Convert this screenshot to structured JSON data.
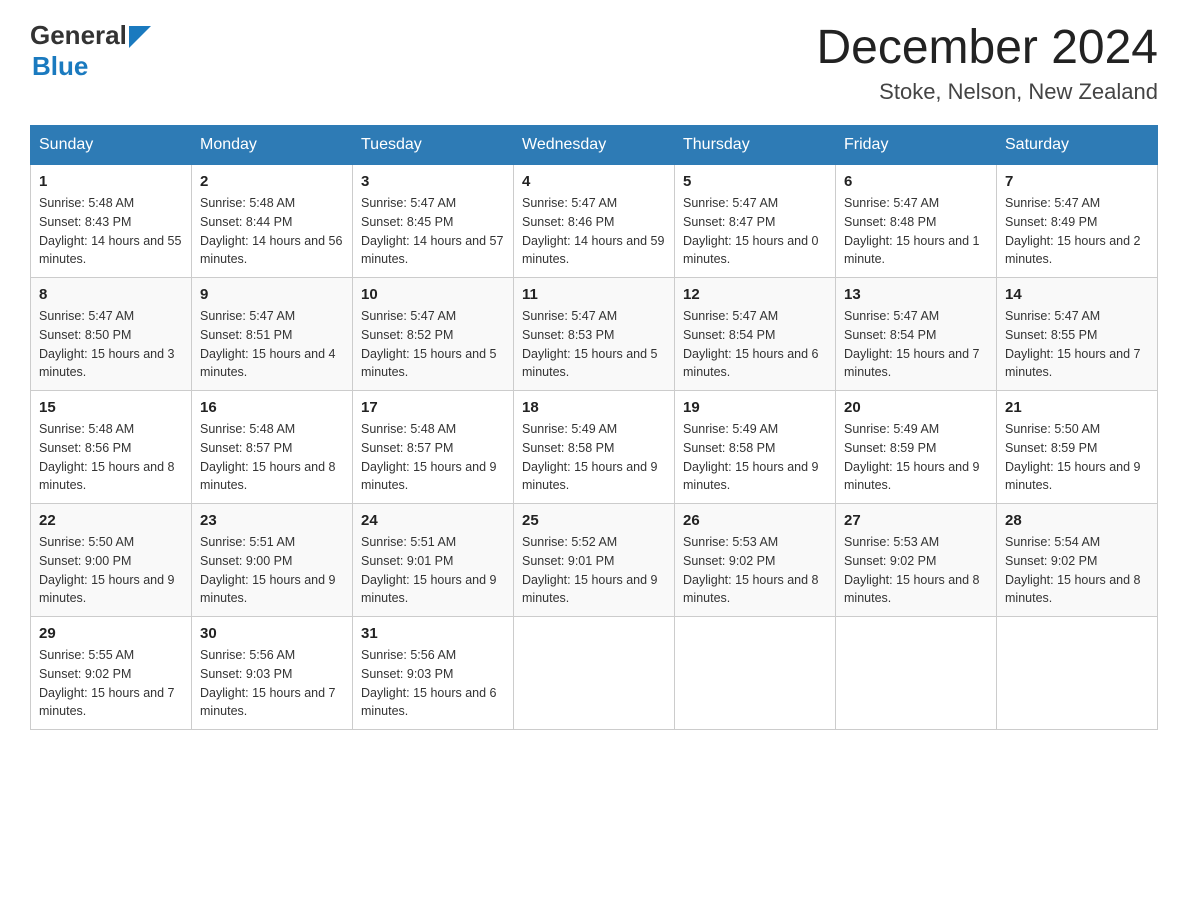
{
  "header": {
    "logo_general": "General",
    "logo_blue": "Blue",
    "title": "December 2024",
    "location": "Stoke, Nelson, New Zealand"
  },
  "weekdays": [
    "Sunday",
    "Monday",
    "Tuesday",
    "Wednesday",
    "Thursday",
    "Friday",
    "Saturday"
  ],
  "weeks": [
    [
      {
        "day": "1",
        "sunrise": "5:48 AM",
        "sunset": "8:43 PM",
        "daylight": "14 hours and 55 minutes."
      },
      {
        "day": "2",
        "sunrise": "5:48 AM",
        "sunset": "8:44 PM",
        "daylight": "14 hours and 56 minutes."
      },
      {
        "day": "3",
        "sunrise": "5:47 AM",
        "sunset": "8:45 PM",
        "daylight": "14 hours and 57 minutes."
      },
      {
        "day": "4",
        "sunrise": "5:47 AM",
        "sunset": "8:46 PM",
        "daylight": "14 hours and 59 minutes."
      },
      {
        "day": "5",
        "sunrise": "5:47 AM",
        "sunset": "8:47 PM",
        "daylight": "15 hours and 0 minutes."
      },
      {
        "day": "6",
        "sunrise": "5:47 AM",
        "sunset": "8:48 PM",
        "daylight": "15 hours and 1 minute."
      },
      {
        "day": "7",
        "sunrise": "5:47 AM",
        "sunset": "8:49 PM",
        "daylight": "15 hours and 2 minutes."
      }
    ],
    [
      {
        "day": "8",
        "sunrise": "5:47 AM",
        "sunset": "8:50 PM",
        "daylight": "15 hours and 3 minutes."
      },
      {
        "day": "9",
        "sunrise": "5:47 AM",
        "sunset": "8:51 PM",
        "daylight": "15 hours and 4 minutes."
      },
      {
        "day": "10",
        "sunrise": "5:47 AM",
        "sunset": "8:52 PM",
        "daylight": "15 hours and 5 minutes."
      },
      {
        "day": "11",
        "sunrise": "5:47 AM",
        "sunset": "8:53 PM",
        "daylight": "15 hours and 5 minutes."
      },
      {
        "day": "12",
        "sunrise": "5:47 AM",
        "sunset": "8:54 PM",
        "daylight": "15 hours and 6 minutes."
      },
      {
        "day": "13",
        "sunrise": "5:47 AM",
        "sunset": "8:54 PM",
        "daylight": "15 hours and 7 minutes."
      },
      {
        "day": "14",
        "sunrise": "5:47 AM",
        "sunset": "8:55 PM",
        "daylight": "15 hours and 7 minutes."
      }
    ],
    [
      {
        "day": "15",
        "sunrise": "5:48 AM",
        "sunset": "8:56 PM",
        "daylight": "15 hours and 8 minutes."
      },
      {
        "day": "16",
        "sunrise": "5:48 AM",
        "sunset": "8:57 PM",
        "daylight": "15 hours and 8 minutes."
      },
      {
        "day": "17",
        "sunrise": "5:48 AM",
        "sunset": "8:57 PM",
        "daylight": "15 hours and 9 minutes."
      },
      {
        "day": "18",
        "sunrise": "5:49 AM",
        "sunset": "8:58 PM",
        "daylight": "15 hours and 9 minutes."
      },
      {
        "day": "19",
        "sunrise": "5:49 AM",
        "sunset": "8:58 PM",
        "daylight": "15 hours and 9 minutes."
      },
      {
        "day": "20",
        "sunrise": "5:49 AM",
        "sunset": "8:59 PM",
        "daylight": "15 hours and 9 minutes."
      },
      {
        "day": "21",
        "sunrise": "5:50 AM",
        "sunset": "8:59 PM",
        "daylight": "15 hours and 9 minutes."
      }
    ],
    [
      {
        "day": "22",
        "sunrise": "5:50 AM",
        "sunset": "9:00 PM",
        "daylight": "15 hours and 9 minutes."
      },
      {
        "day": "23",
        "sunrise": "5:51 AM",
        "sunset": "9:00 PM",
        "daylight": "15 hours and 9 minutes."
      },
      {
        "day": "24",
        "sunrise": "5:51 AM",
        "sunset": "9:01 PM",
        "daylight": "15 hours and 9 minutes."
      },
      {
        "day": "25",
        "sunrise": "5:52 AM",
        "sunset": "9:01 PM",
        "daylight": "15 hours and 9 minutes."
      },
      {
        "day": "26",
        "sunrise": "5:53 AM",
        "sunset": "9:02 PM",
        "daylight": "15 hours and 8 minutes."
      },
      {
        "day": "27",
        "sunrise": "5:53 AM",
        "sunset": "9:02 PM",
        "daylight": "15 hours and 8 minutes."
      },
      {
        "day": "28",
        "sunrise": "5:54 AM",
        "sunset": "9:02 PM",
        "daylight": "15 hours and 8 minutes."
      }
    ],
    [
      {
        "day": "29",
        "sunrise": "5:55 AM",
        "sunset": "9:02 PM",
        "daylight": "15 hours and 7 minutes."
      },
      {
        "day": "30",
        "sunrise": "5:56 AM",
        "sunset": "9:03 PM",
        "daylight": "15 hours and 7 minutes."
      },
      {
        "day": "31",
        "sunrise": "5:56 AM",
        "sunset": "9:03 PM",
        "daylight": "15 hours and 6 minutes."
      },
      null,
      null,
      null,
      null
    ]
  ],
  "labels": {
    "sunrise": "Sunrise:",
    "sunset": "Sunset:",
    "daylight": "Daylight:"
  }
}
